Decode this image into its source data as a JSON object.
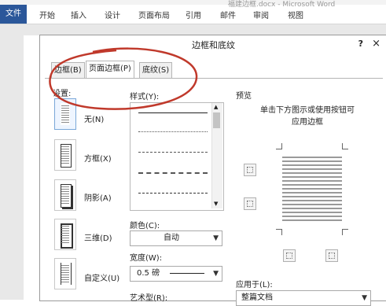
{
  "window": {
    "doc_title": "福建边框.docx - Microsoft Word"
  },
  "ribbon": {
    "file_tab": "文件",
    "tabs": [
      "开始",
      "插入",
      "设计",
      "页面布局",
      "引用",
      "邮件",
      "审阅",
      "视图"
    ]
  },
  "dialog": {
    "title": "边框和底纹",
    "help": "?",
    "close": "×",
    "tabs": [
      "边框(B)",
      "页面边框(P)",
      "底纹(S)"
    ],
    "settings": {
      "label": "设置:",
      "items": [
        "无(N)",
        "方框(X)",
        "阴影(A)",
        "三维(D)",
        "自定义(U)"
      ]
    },
    "style": {
      "label": "样式(Y):"
    },
    "color": {
      "label": "颜色(C):",
      "value": "自动"
    },
    "width": {
      "label": "宽度(W):",
      "value": "0.5 磅"
    },
    "art": {
      "label": "艺术型(R):"
    },
    "preview": {
      "label": "预览",
      "hint_line1": "单击下方图示或使用按钮可",
      "hint_line2": "应用边框"
    },
    "apply_to": {
      "label": "应用于(L):",
      "value": "整篇文档"
    }
  }
}
